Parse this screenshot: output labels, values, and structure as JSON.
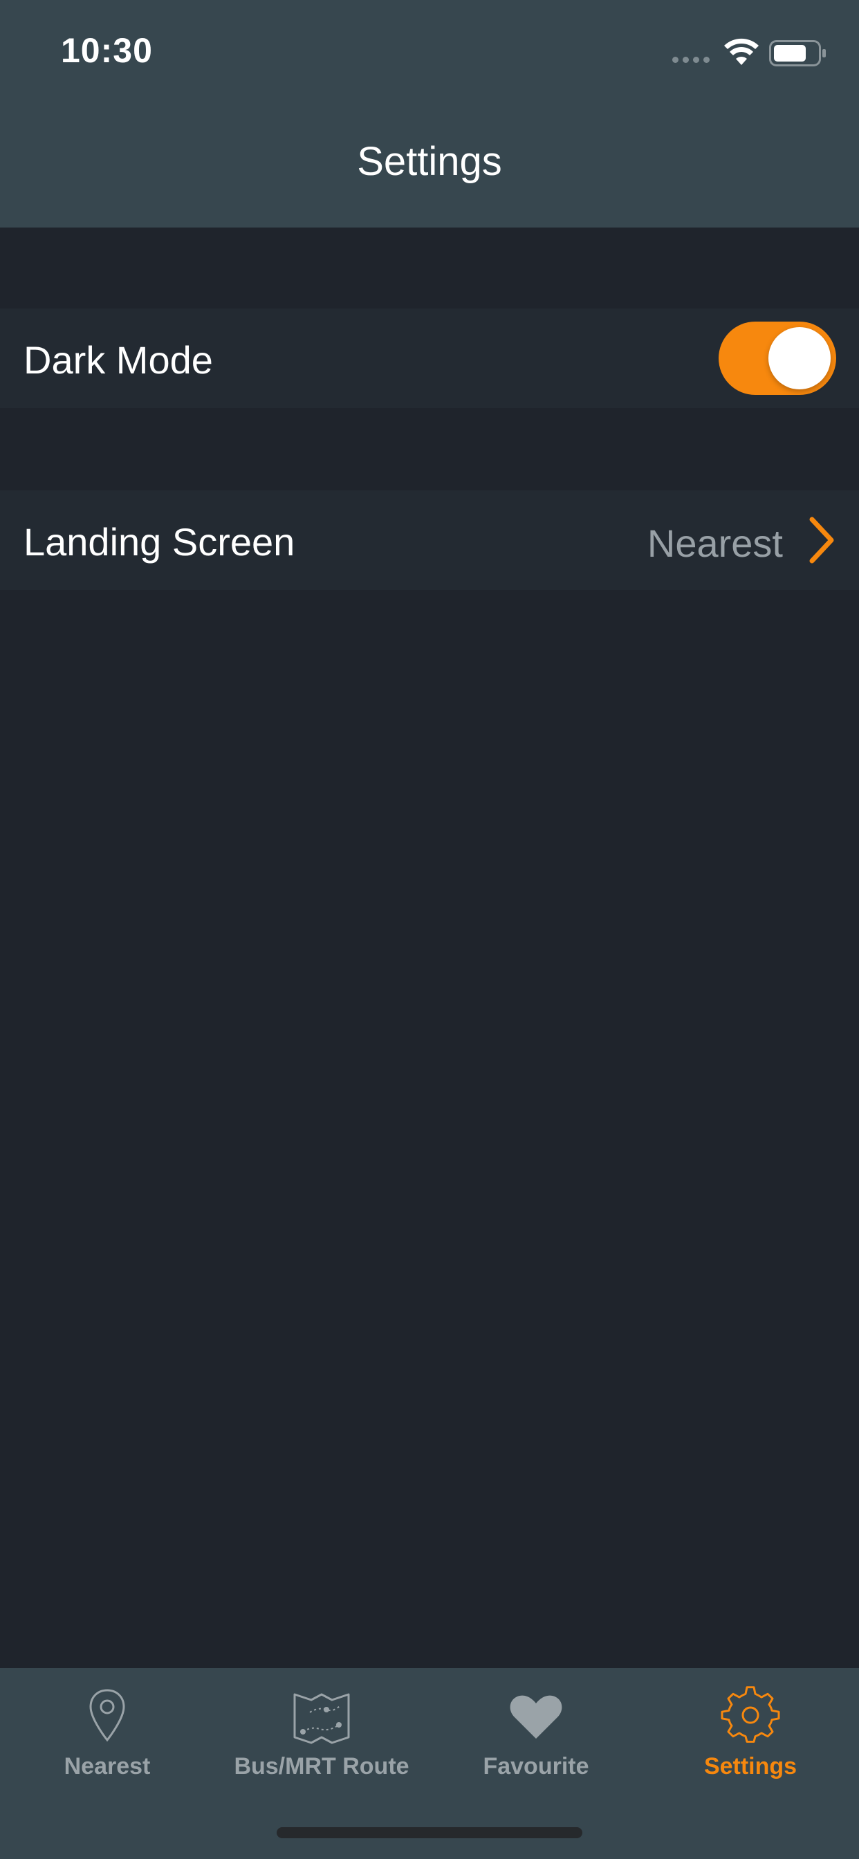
{
  "status_bar": {
    "time": "10:30",
    "wifi_icon": "wifi-icon",
    "battery_icon": "battery-icon",
    "signal_icon": "signal-dots-icon"
  },
  "nav": {
    "title": "Settings"
  },
  "settings": {
    "dark_mode": {
      "label": "Dark Mode",
      "enabled": true
    },
    "landing_screen": {
      "label": "Landing Screen",
      "value": "Nearest",
      "chevron_icon": "chevron-right-icon"
    }
  },
  "tabs": [
    {
      "label": "Nearest",
      "icon": "location-pin-icon",
      "active": false
    },
    {
      "label": "Bus/MRT Route",
      "icon": "route-map-icon",
      "active": false
    },
    {
      "label": "Favourite",
      "icon": "heart-icon",
      "active": false
    },
    {
      "label": "Settings",
      "icon": "gear-icon",
      "active": true
    }
  ],
  "colors": {
    "accent": "#f7880e",
    "header_bg": "#37474f",
    "page_bg": "#1f242c",
    "row_bg": "#232a32",
    "inactive_tab": "#9aa3a8"
  }
}
